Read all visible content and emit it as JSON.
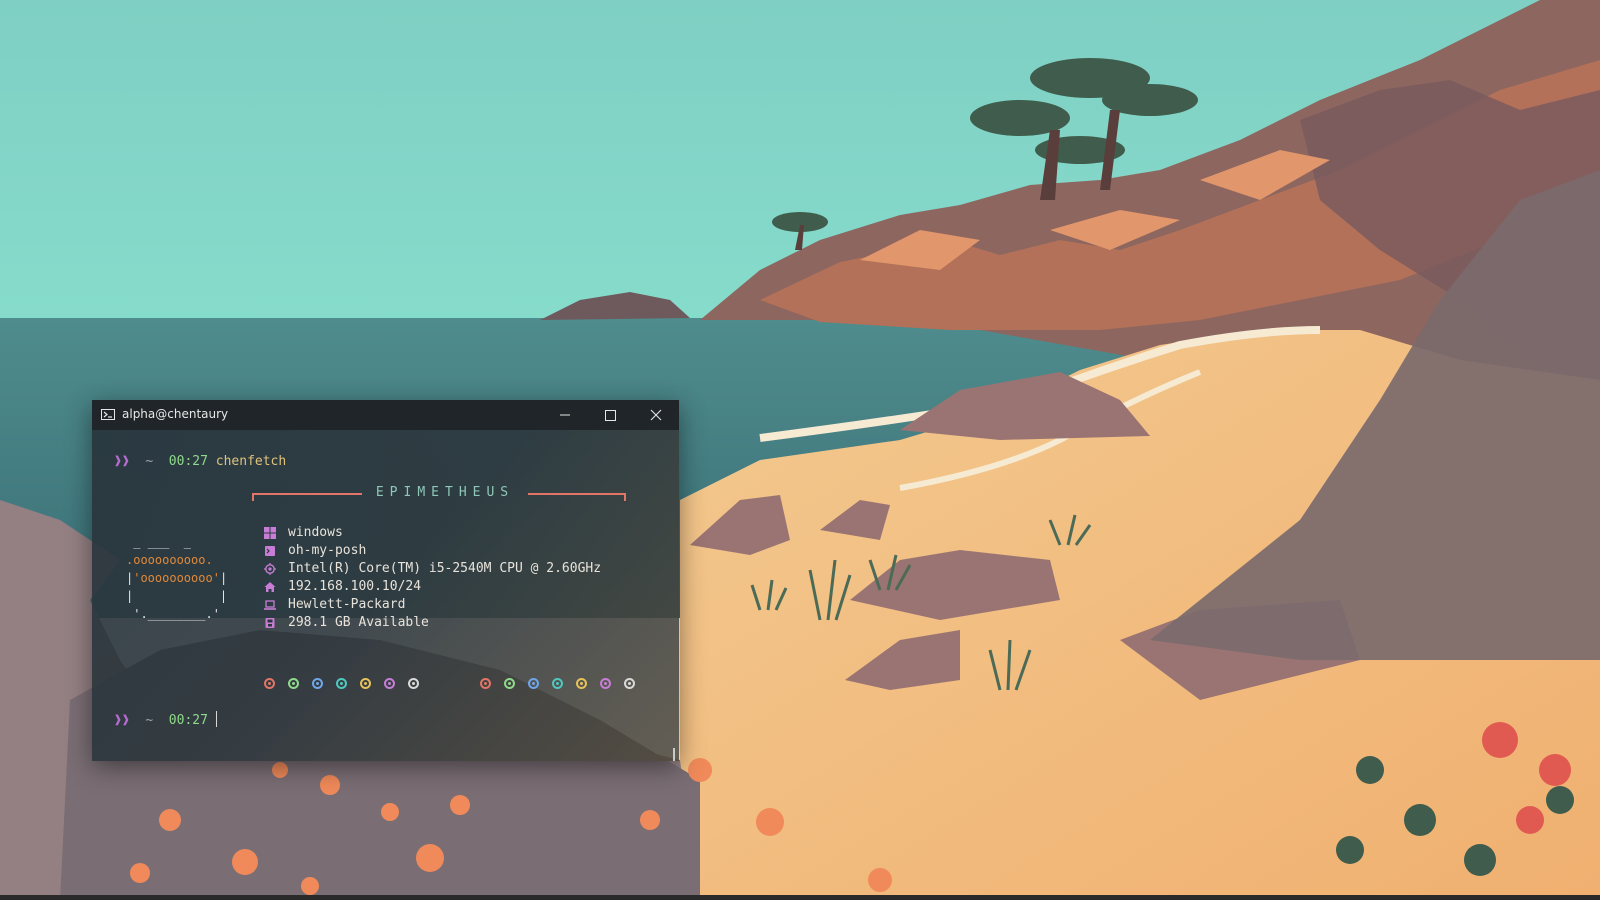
{
  "window": {
    "title": "alpha@chentaury"
  },
  "terminal": {
    "prompt1": {
      "arrow": "❱❱",
      "tilde": "~",
      "time": "00:27",
      "command": "chenfetch"
    },
    "banner": "EPIMETHEUS",
    "ascii_art": {
      "line1": " _ ___  _",
      "line2": ".oooooooooo.",
      "line3_left": "|",
      "line3_mid": "'oooooooooo'",
      "line3_right": "|",
      "line4": "|            |",
      "line5": " '.________.'"
    },
    "info": [
      {
        "icon": "windows-icon",
        "text": "windows",
        "color": "#c77dd6"
      },
      {
        "icon": "terminal-icon",
        "text": "oh-my-posh",
        "color": "#c77dd6"
      },
      {
        "icon": "cpu-icon",
        "text": "Intel(R) Core(TM) i5-2540M CPU @ 2.60GHz",
        "color": "#c77dd6"
      },
      {
        "icon": "home-icon",
        "text": "192.168.100.10/24",
        "color": "#c77dd6"
      },
      {
        "icon": "laptop-icon",
        "text": "Hewlett-Packard",
        "color": "#c77dd6"
      },
      {
        "icon": "disk-icon",
        "text": "298.1 GB Available",
        "color": "#c77dd6"
      }
    ],
    "palette": [
      "#e27468",
      "#8fd98a",
      "#6fa6e8",
      "#4fc8c0",
      "#e6c25a",
      "#c77dd6",
      "#d9d9d9",
      "#e27468",
      "#8fd98a",
      "#6fa6e8",
      "#4fc8c0",
      "#e6c25a",
      "#c77dd6",
      "#d9d9d9"
    ],
    "prompt2": {
      "arrow": "❱❱",
      "tilde": "~",
      "time": "00:27"
    }
  }
}
